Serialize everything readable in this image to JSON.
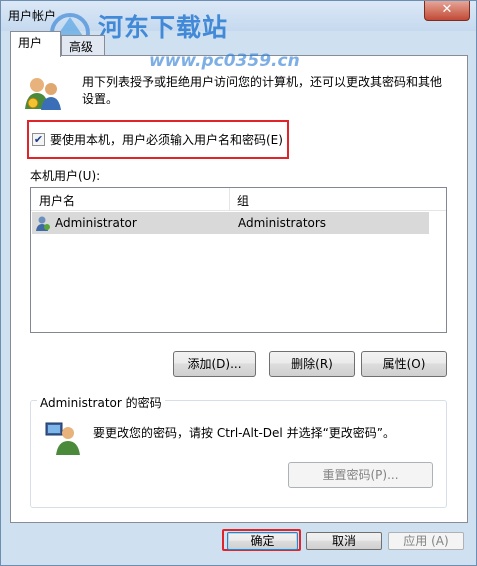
{
  "window": {
    "title": "用户帐户",
    "close_label": "✕"
  },
  "watermark": {
    "text": "河东下载站",
    "url": "www.pc0359.cn"
  },
  "tabs": [
    {
      "label": "用户"
    },
    {
      "label": "高级"
    }
  ],
  "intro_text": "用下列表授予或拒绝用户访问您的计算机，还可以更改其密码和其他设置。",
  "require_login": {
    "label": "要使用本机，用户必须输入用户名和密码(E)",
    "checked": true
  },
  "users_section_label": "本机用户(U):",
  "table": {
    "columns": [
      "用户名",
      "组"
    ],
    "rows": [
      {
        "username": "Administrator",
        "group": "Administrators"
      }
    ]
  },
  "buttons": {
    "add": "添加(D)...",
    "remove": "删除(R)",
    "properties": "属性(O)"
  },
  "password_group": {
    "title": "Administrator 的密码",
    "text": "要更改您的密码，请按 Ctrl-Alt-Del 并选择“更改密码”。",
    "reset_label": "重置密码(P)..."
  },
  "footer": {
    "ok": "确定",
    "cancel": "取消",
    "apply": "应用 (A)"
  }
}
